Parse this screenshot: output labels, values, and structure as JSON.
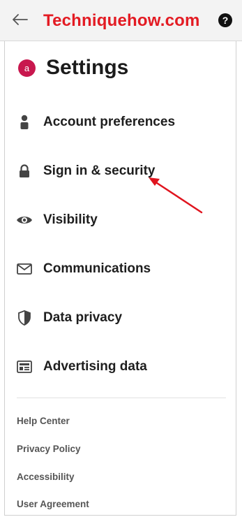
{
  "topbar": {
    "brand": "Techniquehow.com",
    "help_glyph": "?"
  },
  "header": {
    "avatar_letter": "a",
    "title": "Settings"
  },
  "menu": [
    {
      "label": "Account preferences",
      "icon": "person-icon"
    },
    {
      "label": "Sign in & security",
      "icon": "lock-icon"
    },
    {
      "label": "Visibility",
      "icon": "eye-icon"
    },
    {
      "label": "Communications",
      "icon": "envelope-icon"
    },
    {
      "label": "Data privacy",
      "icon": "shield-icon"
    },
    {
      "label": "Advertising data",
      "icon": "ad-card-icon"
    }
  ],
  "footer": [
    "Help Center",
    "Privacy Policy",
    "Accessibility",
    "User Agreement"
  ],
  "colors": {
    "brand": "#e31b23",
    "avatar": "#c8174e",
    "annotation_arrow": "#e0141e"
  }
}
